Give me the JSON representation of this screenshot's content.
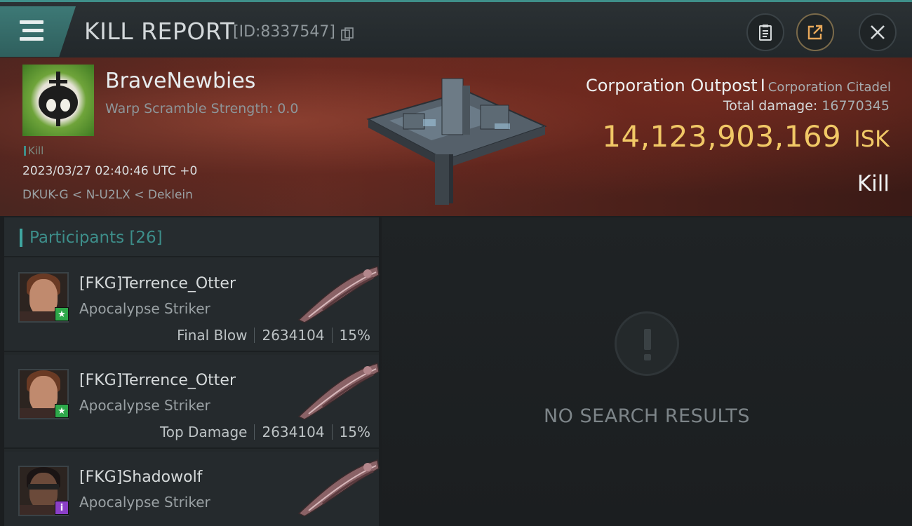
{
  "header": {
    "title": "KILL REPORT",
    "id_text": "[ID:8337547]"
  },
  "victim": {
    "corp_name": "BraveNewbies",
    "warp_text": "Warp Scramble Strength: 0.0",
    "tag": "Kill",
    "timestamp": "2023/03/27 02:40:46 UTC +0",
    "location": "DKUK-G < N-U2LX < Deklein",
    "ship_name": "Corporation Outpost",
    "separator": "I",
    "ship_class": "Corporation Citadel",
    "total_damage_label": "Total damage:",
    "total_damage_value": "16770345",
    "isk_amount": "14,123,903,169",
    "isk_unit": "ISK",
    "result_label": "Kill"
  },
  "participants_panel": {
    "label": "Participants [26]",
    "items": [
      {
        "name": "[FKG]Terrence_Otter",
        "ship": "Apocalypse Striker",
        "role": "Final Blow",
        "damage": "2634104",
        "percent": "15%",
        "badge": "★",
        "badge_color": "#2ea84a",
        "portrait": "female-pilot"
      },
      {
        "name": "[FKG]Terrence_Otter",
        "ship": "Apocalypse Striker",
        "role": "Top Damage",
        "damage": "2634104",
        "percent": "15%",
        "badge": "★",
        "badge_color": "#2ea84a",
        "portrait": "female-pilot"
      },
      {
        "name": "[FKG]Shadowolf",
        "ship": "Apocalypse Striker",
        "badge": "i",
        "badge_color": "#8b3fc7",
        "portrait": "male-pilot-visor"
      }
    ]
  },
  "results_panel": {
    "empty_text": "NO SEARCH RESULTS",
    "icon": "exclamation-icon"
  },
  "colors": {
    "accent_teal": "#3f8f8a",
    "isk_gold": "#f1c866"
  }
}
